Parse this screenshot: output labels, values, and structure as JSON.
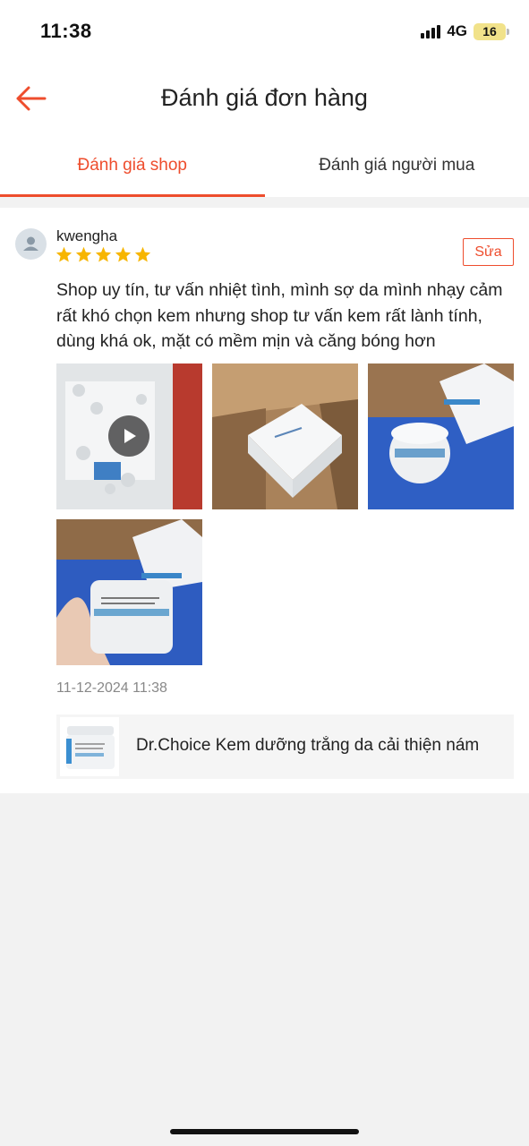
{
  "status_bar": {
    "time": "11:38",
    "network": "4G",
    "battery": "16"
  },
  "header": {
    "title": "Đánh giá đơn hàng",
    "back_icon": "arrow-left-icon"
  },
  "tabs": [
    {
      "label": "Đánh giá shop",
      "active": true
    },
    {
      "label": "Đánh giá người mua",
      "active": false
    }
  ],
  "review": {
    "username": "kwengha",
    "rating": 5,
    "edit_label": "Sửa",
    "text": "Shop uy tín, tư vấn nhiệt tình, mình sợ da mình nhạy cảm rất khó chọn kem nhưng shop tư vấn kem rất lành tính, dùng khá ok, mặt có mềm mịn và căng bóng hơn",
    "media": [
      {
        "type": "video",
        "subject": "bubble-wrap package"
      },
      {
        "type": "image",
        "subject": "open cardboard box"
      },
      {
        "type": "image",
        "subject": "cream jar on blue towel"
      },
      {
        "type": "image",
        "subject": "hand holding cream jar"
      }
    ],
    "date": "11-12-2024 11:38",
    "product": {
      "name": "Dr.Choice Kem dưỡng trắng da cải thiện nám"
    }
  },
  "colors": {
    "accent": "#ee4d2d",
    "star": "#f7b500",
    "background": "#f2f2f2"
  }
}
